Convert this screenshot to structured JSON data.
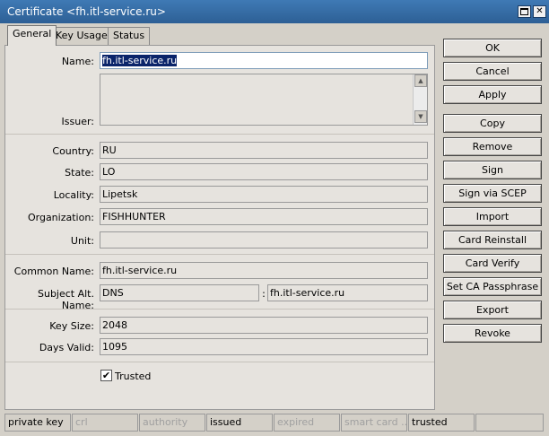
{
  "window": {
    "title": "Certificate <fh.itl-service.ru>"
  },
  "tabs": [
    {
      "label": "General"
    },
    {
      "label": "Key Usage"
    },
    {
      "label": "Status"
    }
  ],
  "form": {
    "name_label": "Name:",
    "name_value": "fh.itl-service.ru",
    "issuer_label": "Issuer:",
    "country_label": "Country:",
    "country_value": "RU",
    "state_label": "State:",
    "state_value": "LO",
    "locality_label": "Locality:",
    "locality_value": "Lipetsk",
    "organization_label": "Organization:",
    "organization_value": "FISHHUNTER",
    "unit_label": "Unit:",
    "unit_value": "",
    "common_name_label": "Common Name:",
    "common_name_value": "fh.itl-service.ru",
    "san_label": "Subject Alt. Name:",
    "san_type": "DNS",
    "san_colon": ":",
    "san_value": "fh.itl-service.ru",
    "key_size_label": "Key Size:",
    "key_size_value": "2048",
    "days_valid_label": "Days Valid:",
    "days_valid_value": "1095",
    "trusted_label": "Trusted",
    "trusted_checked": "✔"
  },
  "buttons": {
    "ok": "OK",
    "cancel": "Cancel",
    "apply": "Apply",
    "copy": "Copy",
    "remove": "Remove",
    "sign": "Sign",
    "sign_scep": "Sign via SCEP",
    "import": "Import",
    "card_reinstall": "Card Reinstall",
    "card_verify": "Card Verify",
    "set_ca_passphrase": "Set CA Passphrase",
    "export": "Export",
    "revoke": "Revoke"
  },
  "status": {
    "private_key": "private key",
    "crl": "crl",
    "authority": "authority",
    "issued": "issued",
    "expired": "expired",
    "smart_card": "smart card ...",
    "trusted": "trusted"
  },
  "icons": {
    "maximize": "maximize-icon",
    "close": "close-icon"
  }
}
